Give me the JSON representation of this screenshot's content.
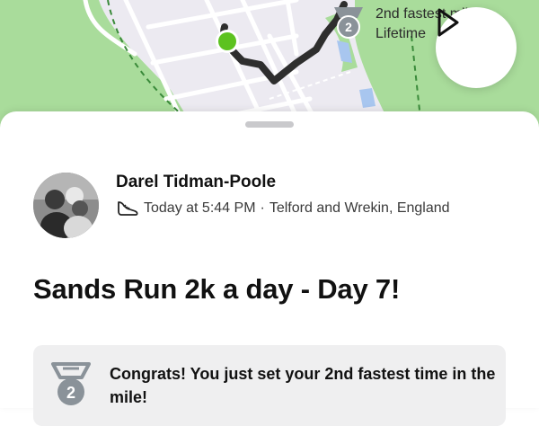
{
  "map": {
    "achievement_rank": "2",
    "achievement_line1": "2nd fastest mile",
    "achievement_line2": "Lifetime",
    "play_icon": "play-icon"
  },
  "activity": {
    "athlete_name": "Darel Tidman-Poole",
    "timestamp": "Today at 5:44 PM",
    "separator": "·",
    "location": "Telford and Wrekin, England",
    "sport_icon": "running-shoe-icon",
    "title": "Sands Run 2k a day - Day 7!"
  },
  "achievement_card": {
    "rank": "2",
    "message": "Congrats! You just set your 2nd fastest time in the mile!",
    "icon": "medal-icon"
  },
  "colors": {
    "route": "#2e2e2e",
    "start_marker": "#5cc21f",
    "medal": "#8a9299",
    "park_green": "#a9dc9b"
  }
}
